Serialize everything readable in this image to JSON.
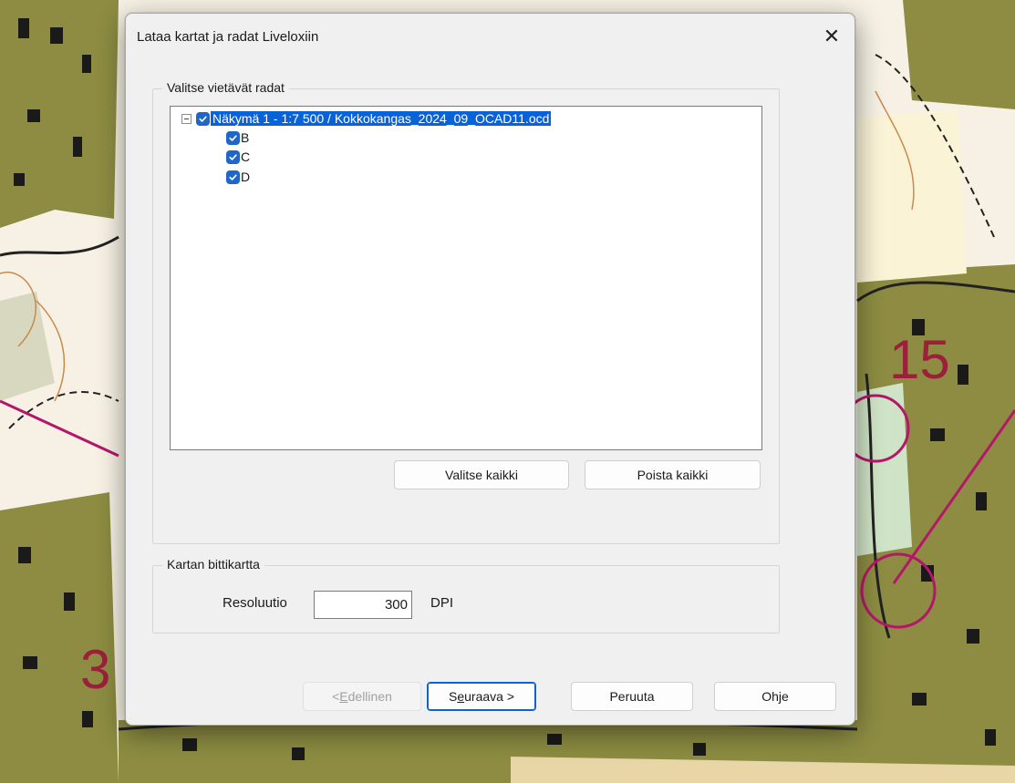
{
  "dialog": {
    "title": "Lataa kartat ja radat Liveloxiin",
    "close_glyph": "✕"
  },
  "courses_group": {
    "label": "Valitse vietävät radat",
    "tree": {
      "root": {
        "label": "Näkymä 1 - 1:7 500 / Kokkokangas_2024_09_OCAD11.ocd",
        "checked": true,
        "expanded": true
      },
      "children": [
        {
          "label": "B",
          "checked": true
        },
        {
          "label": "C",
          "checked": true
        },
        {
          "label": "D",
          "checked": true
        }
      ]
    },
    "select_all_label": "Valitse kaikki",
    "remove_all_label": "Poista kaikki"
  },
  "bitmap_group": {
    "label": "Kartan bittikartta",
    "resolution_label": "Resoluutio",
    "resolution_value": "300",
    "unit": "DPI"
  },
  "footer": {
    "back_prefix": "< ",
    "back_mnemonic": "E",
    "back_rest": "dellinen",
    "next_prefix": "S",
    "next_mnemonic": "e",
    "next_rest": "uraava >",
    "cancel_label": "Peruuta",
    "help_label": "Ohje"
  },
  "colors": {
    "accent": "#0a63d6",
    "dialog_bg": "#f0f0f0",
    "map_forest": "#8b8b3e",
    "map_open": "#f6f1e4",
    "map_course": "#b4176a"
  }
}
